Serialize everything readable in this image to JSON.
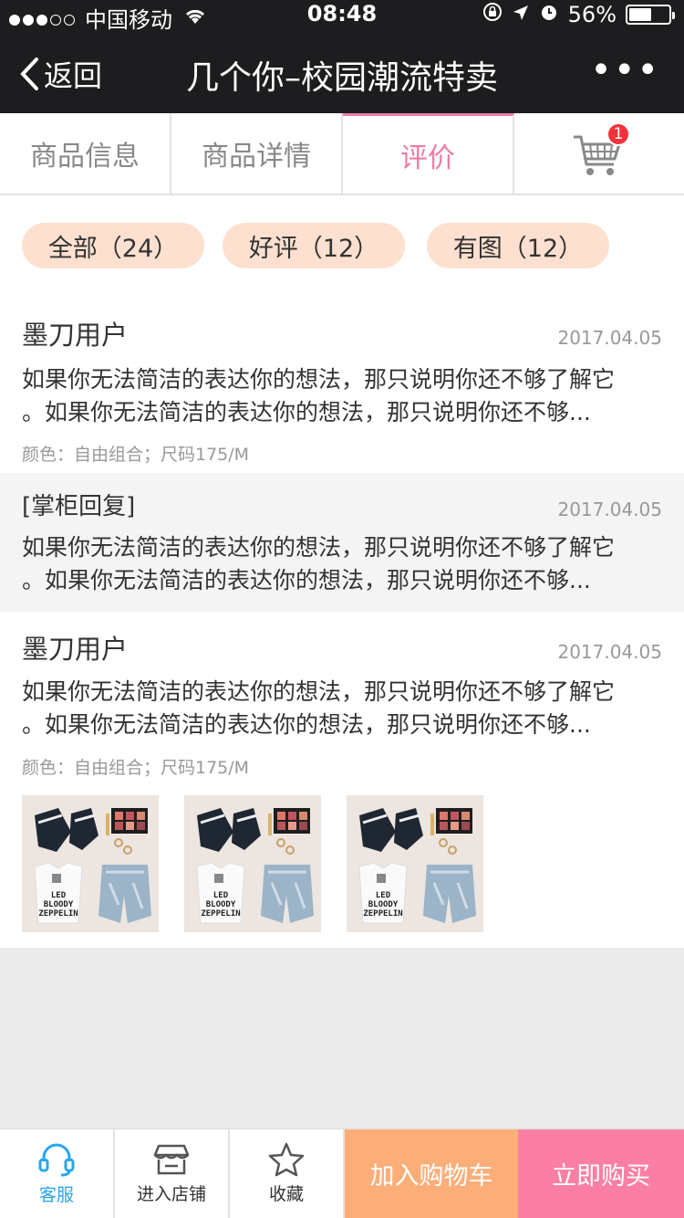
{
  "status": {
    "carrier": "中国移动",
    "time": "08:48",
    "battery": "56%",
    "battery_level": 0.56
  },
  "nav": {
    "back": "返回",
    "title": "几个你–校园潮流特卖",
    "more": "•••"
  },
  "tabs": [
    {
      "label": "商品信息"
    },
    {
      "label": "商品详情"
    },
    {
      "label": "评价"
    }
  ],
  "cart_badge": "1",
  "filters": [
    {
      "label": "全部（24）"
    },
    {
      "label": "好评（12）"
    },
    {
      "label": "有图（12）"
    }
  ],
  "reviews": [
    {
      "user": "墨刀用户",
      "date": "2017.04.05",
      "lines": [
        "如果你无法简洁的表达你的想法，那只说明你还不够了解它",
        "。如果你无法简洁的表达你的想法，那只说明你还不够..."
      ],
      "meta": "颜色：自由组合；尺码175/M"
    },
    {
      "user": "[掌柜回复]",
      "date": "2017.04.05",
      "lines": [
        "如果你无法简洁的表达你的想法，那只说明你还不够了解它",
        "。如果你无法简洁的表达你的想法，那只说明你还不够..."
      ]
    },
    {
      "user": "墨刀用户",
      "date": "2017.04.05",
      "lines": [
        "如果你无法简洁的表达你的想法，那只说明你还不够了解它",
        "。如果你无法简洁的表达你的想法，那只说明你还不够..."
      ],
      "meta": "颜色：自由组合；尺码175/M"
    }
  ],
  "photo_caption": [
    "LED",
    "BLOODY",
    "ZEPPELIN"
  ],
  "bottom": {
    "service": "客服",
    "shop": "进入店铺",
    "favorite": "收藏",
    "add_cart": "加入购物车",
    "buy_now": "立即购买"
  },
  "colors": {
    "accent_pink": "#f07ba3",
    "chip_bg": "#fde0cf",
    "add_cart_bg": "#fcae79",
    "buy_bg": "#fb7fa5",
    "service_blue": "#29a6f0",
    "badge_red": "#f0323c"
  }
}
